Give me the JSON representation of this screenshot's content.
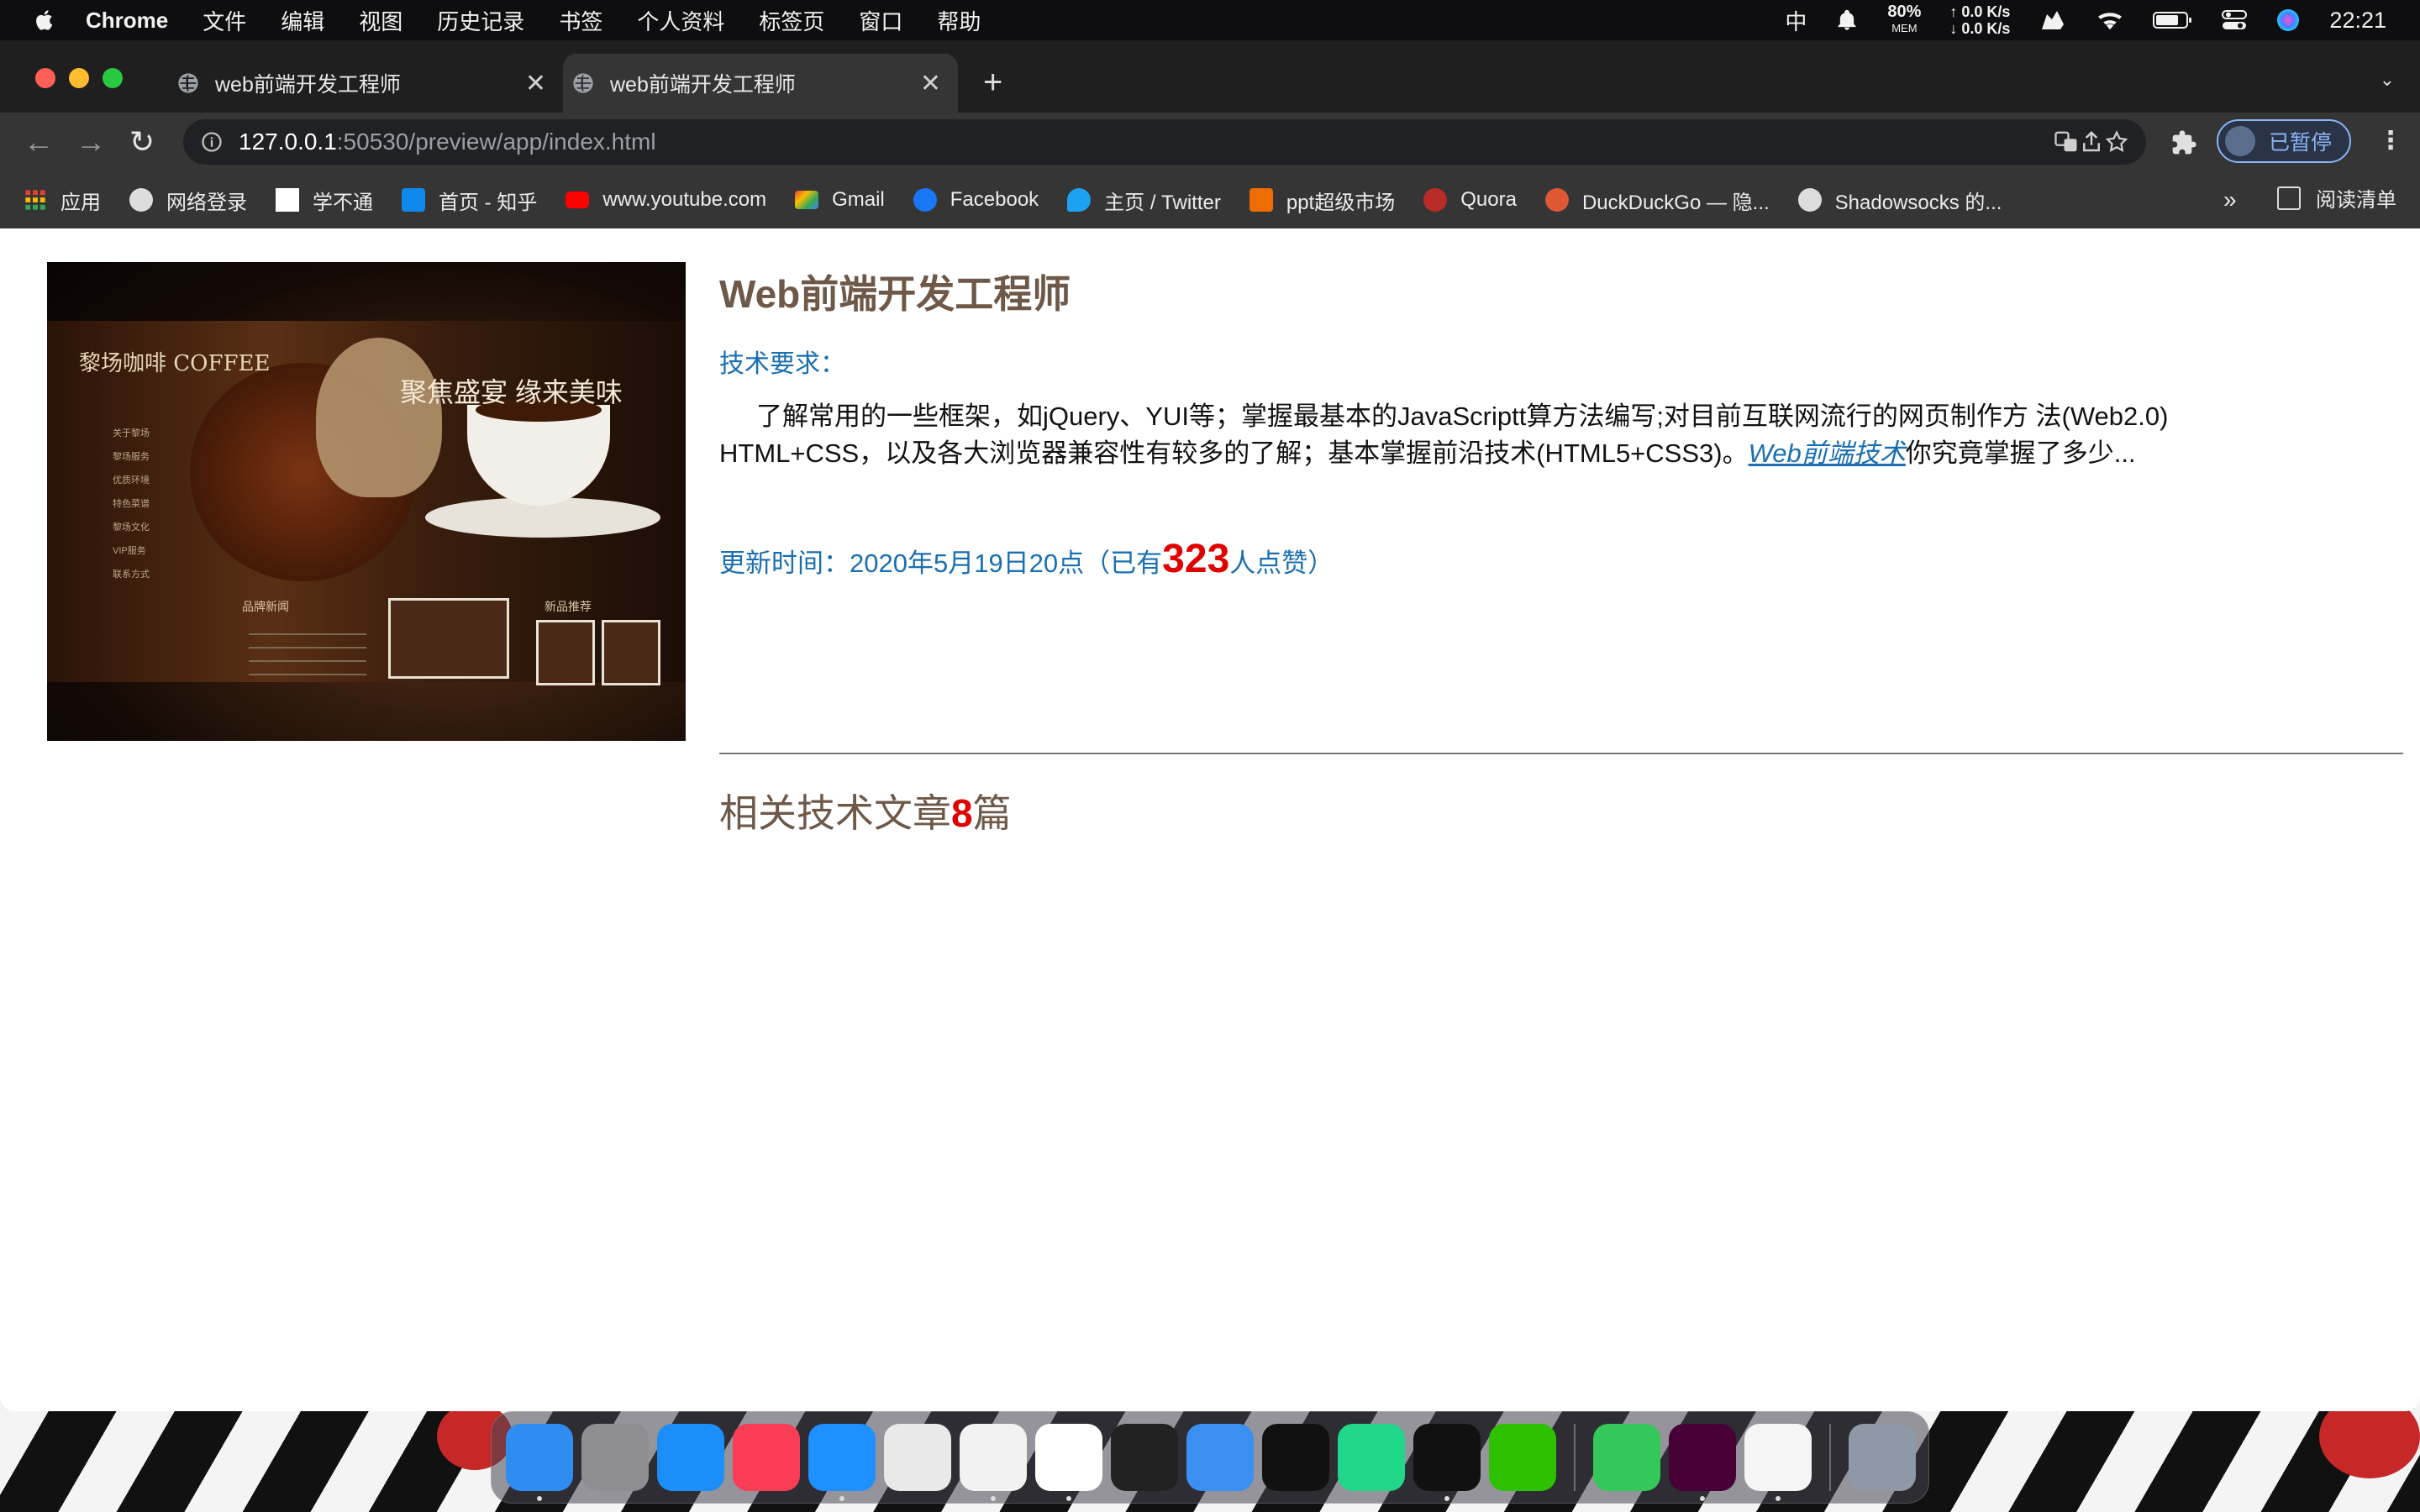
{
  "menubar": {
    "app": "Chrome",
    "items": [
      "文件",
      "编辑",
      "视图",
      "历史记录",
      "书签",
      "个人资料",
      "标签页",
      "窗口",
      "帮助"
    ],
    "ime": "中",
    "mem_percent": "80%",
    "mem_label": "MEM",
    "net_up": "↑ 0.0 K/s",
    "net_down": "↓ 0.0 K/s",
    "clock": "22:21"
  },
  "tabs": [
    {
      "title": "web前端开发工程师",
      "active": false
    },
    {
      "title": "web前端开发工程师",
      "active": true
    }
  ],
  "toolbar": {
    "url_host": "127.0.0.1",
    "url_rest": ":50530/preview/app/index.html",
    "profile_label": "已暂停"
  },
  "bookmarks": [
    {
      "label": "应用",
      "icon": "apps-grid-icon",
      "color": "#e34133"
    },
    {
      "label": "网络登录",
      "icon": "globe-icon",
      "color": "#dddddd"
    },
    {
      "label": "学不通",
      "icon": "page-icon",
      "color": "#ffffff"
    },
    {
      "label": "首页 - 知乎",
      "icon": "zhihu-icon",
      "color": "#0f88eb"
    },
    {
      "label": "www.youtube.com",
      "icon": "youtube-icon",
      "color": "#ff0000"
    },
    {
      "label": "Gmail",
      "icon": "gmail-icon",
      "color": "#ea4335"
    },
    {
      "label": "Facebook",
      "icon": "facebook-icon",
      "color": "#1877f2"
    },
    {
      "label": "主页 / Twitter",
      "icon": "twitter-icon",
      "color": "#1da1f2"
    },
    {
      "label": "ppt超级市场",
      "icon": "ppt-icon",
      "color": "#ef6c00"
    },
    {
      "label": "Quora",
      "icon": "quora-icon",
      "color": "#b92b27"
    },
    {
      "label": "DuckDuckGo — 隐...",
      "icon": "duckduckgo-icon",
      "color": "#de5833"
    },
    {
      "label": "Shadowsocks 的...",
      "icon": "globe-icon",
      "color": "#dddddd"
    }
  ],
  "bookmarks_more": "»",
  "reading_list": "阅读清单",
  "hero": {
    "brand": "黎场咖啡 COFFEE",
    "slogan": "聚焦盛宴 缘来美味",
    "side_menu": [
      "关于黎场",
      "黎场服务",
      "优质环境",
      "特色菜谱",
      "黎场文化",
      "VIP服务",
      "联系方式"
    ],
    "news_title": "品牌新闻",
    "reco_title": "新品推荐"
  },
  "article": {
    "title": "Web前端开发工程师",
    "req_label": "技术要求：",
    "desc_text": "了解常用的一些框架，如jQuery、YUI等；掌握最基本的JavaScriptt算方法编写;对目前互联网流行的网页制作方 法(Web2.0) HTML+CSS，以及各大浏览器兼容性有较多的了解；基本掌握前沿技术(HTML5+CSS3)。",
    "link_text": "Web前端技术",
    "desc_tail": "你究竟掌握了多少...",
    "update_prefix": "更新时间：2020年5月19日20点（已有",
    "likes": "323",
    "update_suffix": "人点赞）",
    "related_prefix": "相关技术文章",
    "related_count": "8",
    "related_suffix": "篇"
  },
  "dock": [
    {
      "name": "finder",
      "color": "#2f8cf0",
      "running": true
    },
    {
      "name": "launchpad",
      "color": "#8e8e93",
      "running": false
    },
    {
      "name": "app-store",
      "color": "#1c8ef9",
      "running": false
    },
    {
      "name": "music",
      "color": "#fa3c55",
      "running": false
    },
    {
      "name": "safari",
      "color": "#1e90ff",
      "running": true
    },
    {
      "name": "preview",
      "color": "#e9e9e9",
      "running": false
    },
    {
      "name": "typora",
      "color": "#f2f2f2",
      "running": true
    },
    {
      "name": "chrome",
      "color": "#ffffff",
      "running": true
    },
    {
      "name": "activity-monitor",
      "color": "#222222",
      "running": false
    },
    {
      "name": "mail",
      "color": "#3a8ff0",
      "running": false
    },
    {
      "name": "terminal",
      "color": "#111111",
      "running": false
    },
    {
      "name": "pycharm",
      "color": "#21d789",
      "running": false
    },
    {
      "name": "qq",
      "color": "#111111",
      "running": true
    },
    {
      "name": "wechat",
      "color": "#2dc100",
      "running": false
    },
    {
      "name": "messages",
      "color": "#34c759",
      "running": false
    },
    {
      "name": "dreamweaver",
      "color": "#470137",
      "running": true
    },
    {
      "name": "wps",
      "color": "#f5f5f5",
      "running": true
    },
    {
      "name": "trash",
      "color": "#8f98a6",
      "running": false
    }
  ]
}
